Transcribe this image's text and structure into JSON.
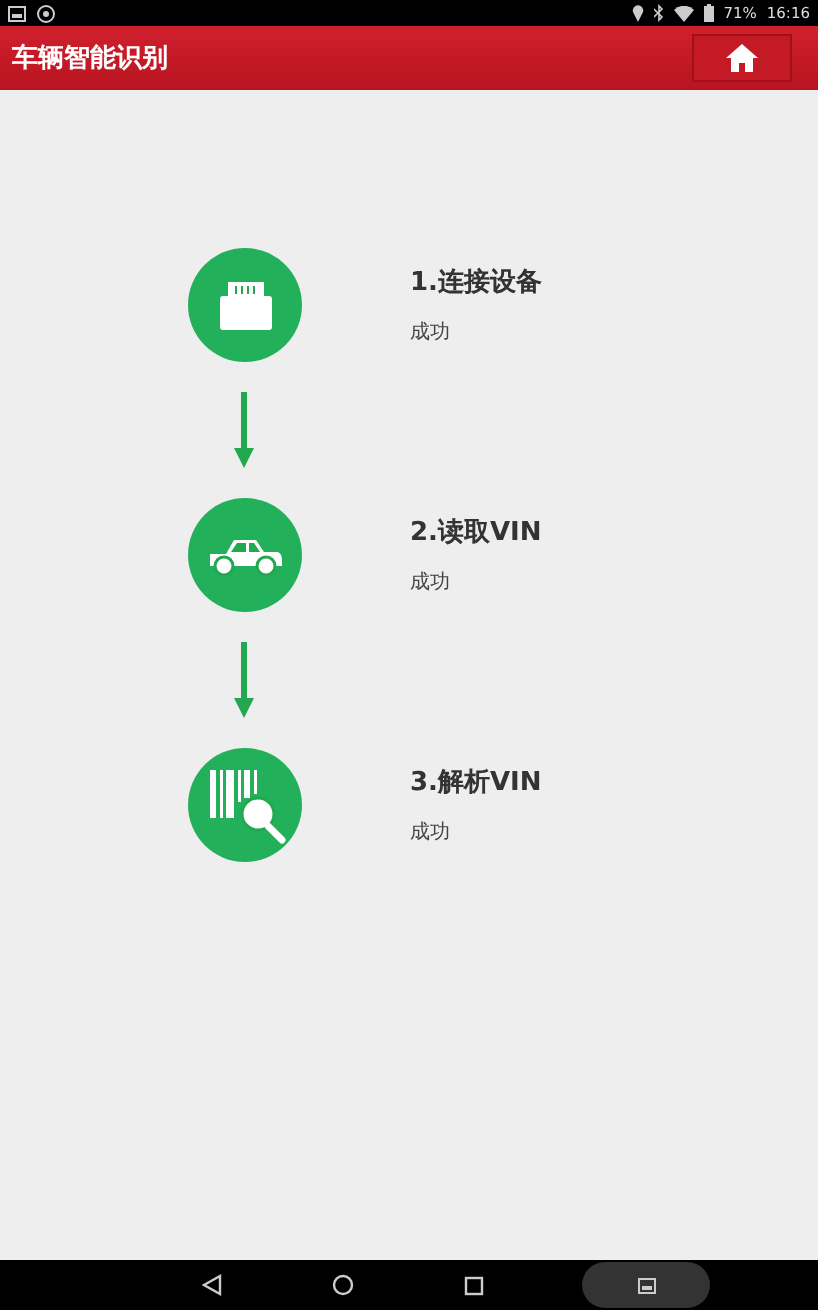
{
  "status_bar": {
    "battery": "71%",
    "time": "16:16"
  },
  "header": {
    "title": "车辆智能识别"
  },
  "steps": [
    {
      "kind": "device",
      "title": "1.连接设备",
      "status": "成功"
    },
    {
      "kind": "car",
      "title": "2.读取VIN",
      "status": "成功"
    },
    {
      "kind": "barcode",
      "title": "3.解析VIN",
      "status": "成功"
    }
  ]
}
